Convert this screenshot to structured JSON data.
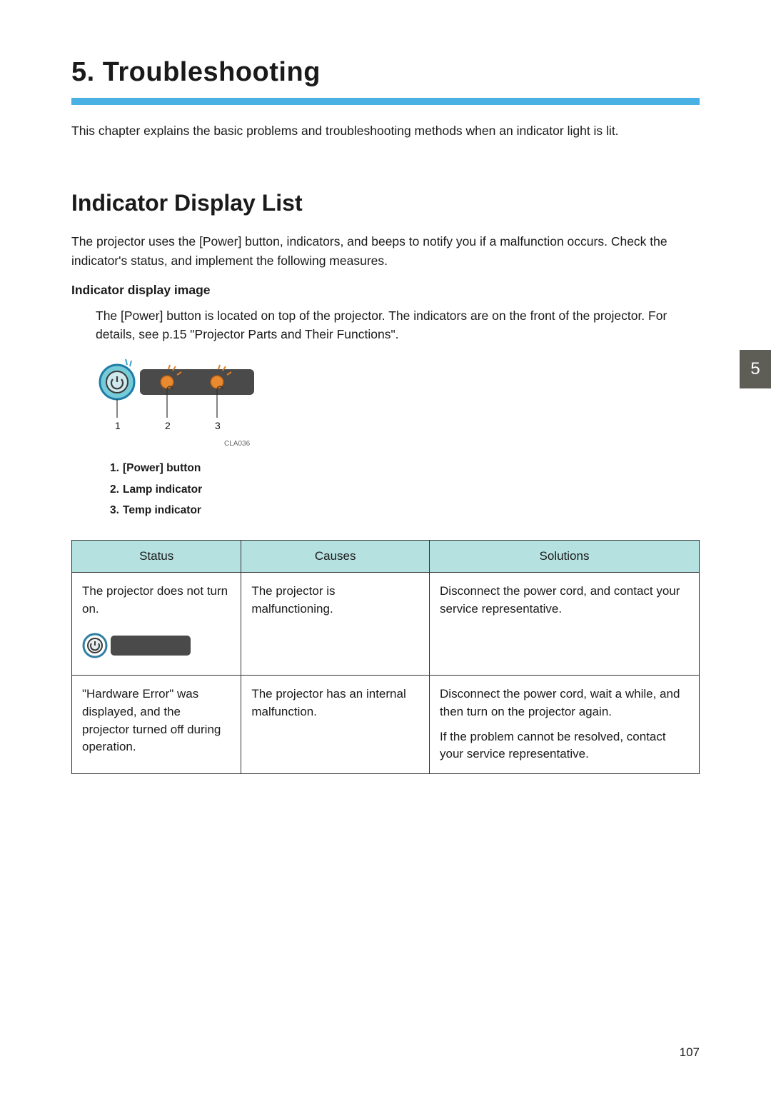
{
  "chapter": {
    "number": "5.",
    "title": "Troubleshooting"
  },
  "intro": "This chapter explains the basic problems and troubleshooting methods when an indicator light is lit.",
  "section": {
    "title": "Indicator Display List",
    "body": "The projector uses the [Power] button, indicators, and beeps to notify you if a malfunction occurs. Check the indicator's status, and implement the following measures."
  },
  "subHeading": "Indicator display image",
  "subBody": "The [Power] button is located on top of the projector. The indicators are on the front of the projector. For details, see p.15 \"Projector Parts and Their Functions\".",
  "diagram": {
    "code": "CLA036",
    "labels": {
      "one": "1",
      "two": "2",
      "three": "3"
    }
  },
  "legend": {
    "items": [
      {
        "num": "1.",
        "text": "[Power] button"
      },
      {
        "num": "2.",
        "text": "Lamp indicator"
      },
      {
        "num": "3.",
        "text": "Temp indicator"
      }
    ]
  },
  "tableHeaders": {
    "status": "Status",
    "causes": "Causes",
    "solutions": "Solutions"
  },
  "rows": [
    {
      "status": "The projector does not turn on.",
      "cause": "The projector is malfunctioning.",
      "solution": "Disconnect the power cord, and contact your service representative."
    },
    {
      "status": "\"Hardware Error\" was displayed, and the projector turned off during operation.",
      "cause": "The projector has an internal malfunction.",
      "solutionA": "Disconnect the power cord, wait a while, and then turn on the projector again.",
      "solutionB": "If the problem cannot be resolved, contact your service representative."
    }
  ],
  "tab": "5",
  "pageNumber": "107"
}
